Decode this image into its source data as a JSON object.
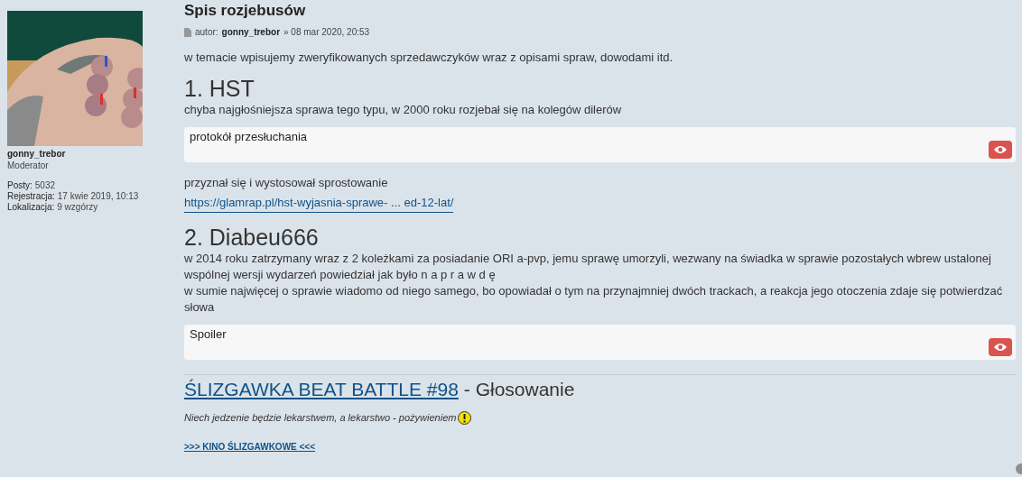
{
  "profile": {
    "username": "gonny_trebor",
    "rank": "Moderator",
    "stats": [
      {
        "label": "Posty:",
        "value": "5032"
      },
      {
        "label": "Rejestracja:",
        "value": "17 kwie 2019, 10:13"
      },
      {
        "label": "Lokalizacja:",
        "value": "9 wzgórzy"
      }
    ]
  },
  "post": {
    "title": "Spis rozjebusów",
    "author_label": "autor:",
    "author": "gonny_trebor",
    "date": "» 08 mar 2020, 20:53"
  },
  "blocks": [
    {
      "kind": "paragraph",
      "lines": [
        "w temacie wpisujemy zweryfikowanych sprzedawczyków wraz z opisami spraw, dowodami itd."
      ]
    },
    {
      "kind": "heading",
      "text": "1. HST"
    },
    {
      "kind": "paragraph",
      "lines": [
        "chyba najgłośniejsza sprawa tego typu, w 2000 roku rozjebał się na kolegów dilerów"
      ]
    },
    {
      "kind": "spoiler",
      "text": "protokół przesłuchania"
    },
    {
      "kind": "paragraph",
      "lines": [
        "przyznał się i wystosował sprostowanie"
      ]
    },
    {
      "kind": "link",
      "text": "https://glamrap.pl/hst-wyjasnia-sprawe- ... ed-12-lat/"
    },
    {
      "kind": "heading",
      "text": "2. Diabeu666"
    },
    {
      "kind": "paragraph",
      "lines": [
        "w 2014 roku zatrzymany wraz z 2 koleżkami za posiadanie ORI a-pvp, jemu sprawę umorzyli, wezwany na świadka w sprawie pozostałych wbrew ustalonej wspólnej wersji wydarzeń powiedział jak było n a p r a w d ę",
        "w sumie najwięcej o sprawie wiadomo od niego samego, bo opowiadał o tym na przynajmniej dwóch trackach, a reakcja jego otoczenia zdaje się potwierdzać słowa"
      ]
    },
    {
      "kind": "spoiler",
      "text": "Spoiler"
    }
  ],
  "signature": {
    "title_link": "ŚLIZGAWKA BEAT BATTLE #98",
    "title_rest": "- Głosowanie",
    "quote": "Niech jedzenie będzie lekarstwem, a lekarstwo - pożywieniem",
    "link": ">>> KINO ŚLIZGAWKOWE <<<"
  }
}
